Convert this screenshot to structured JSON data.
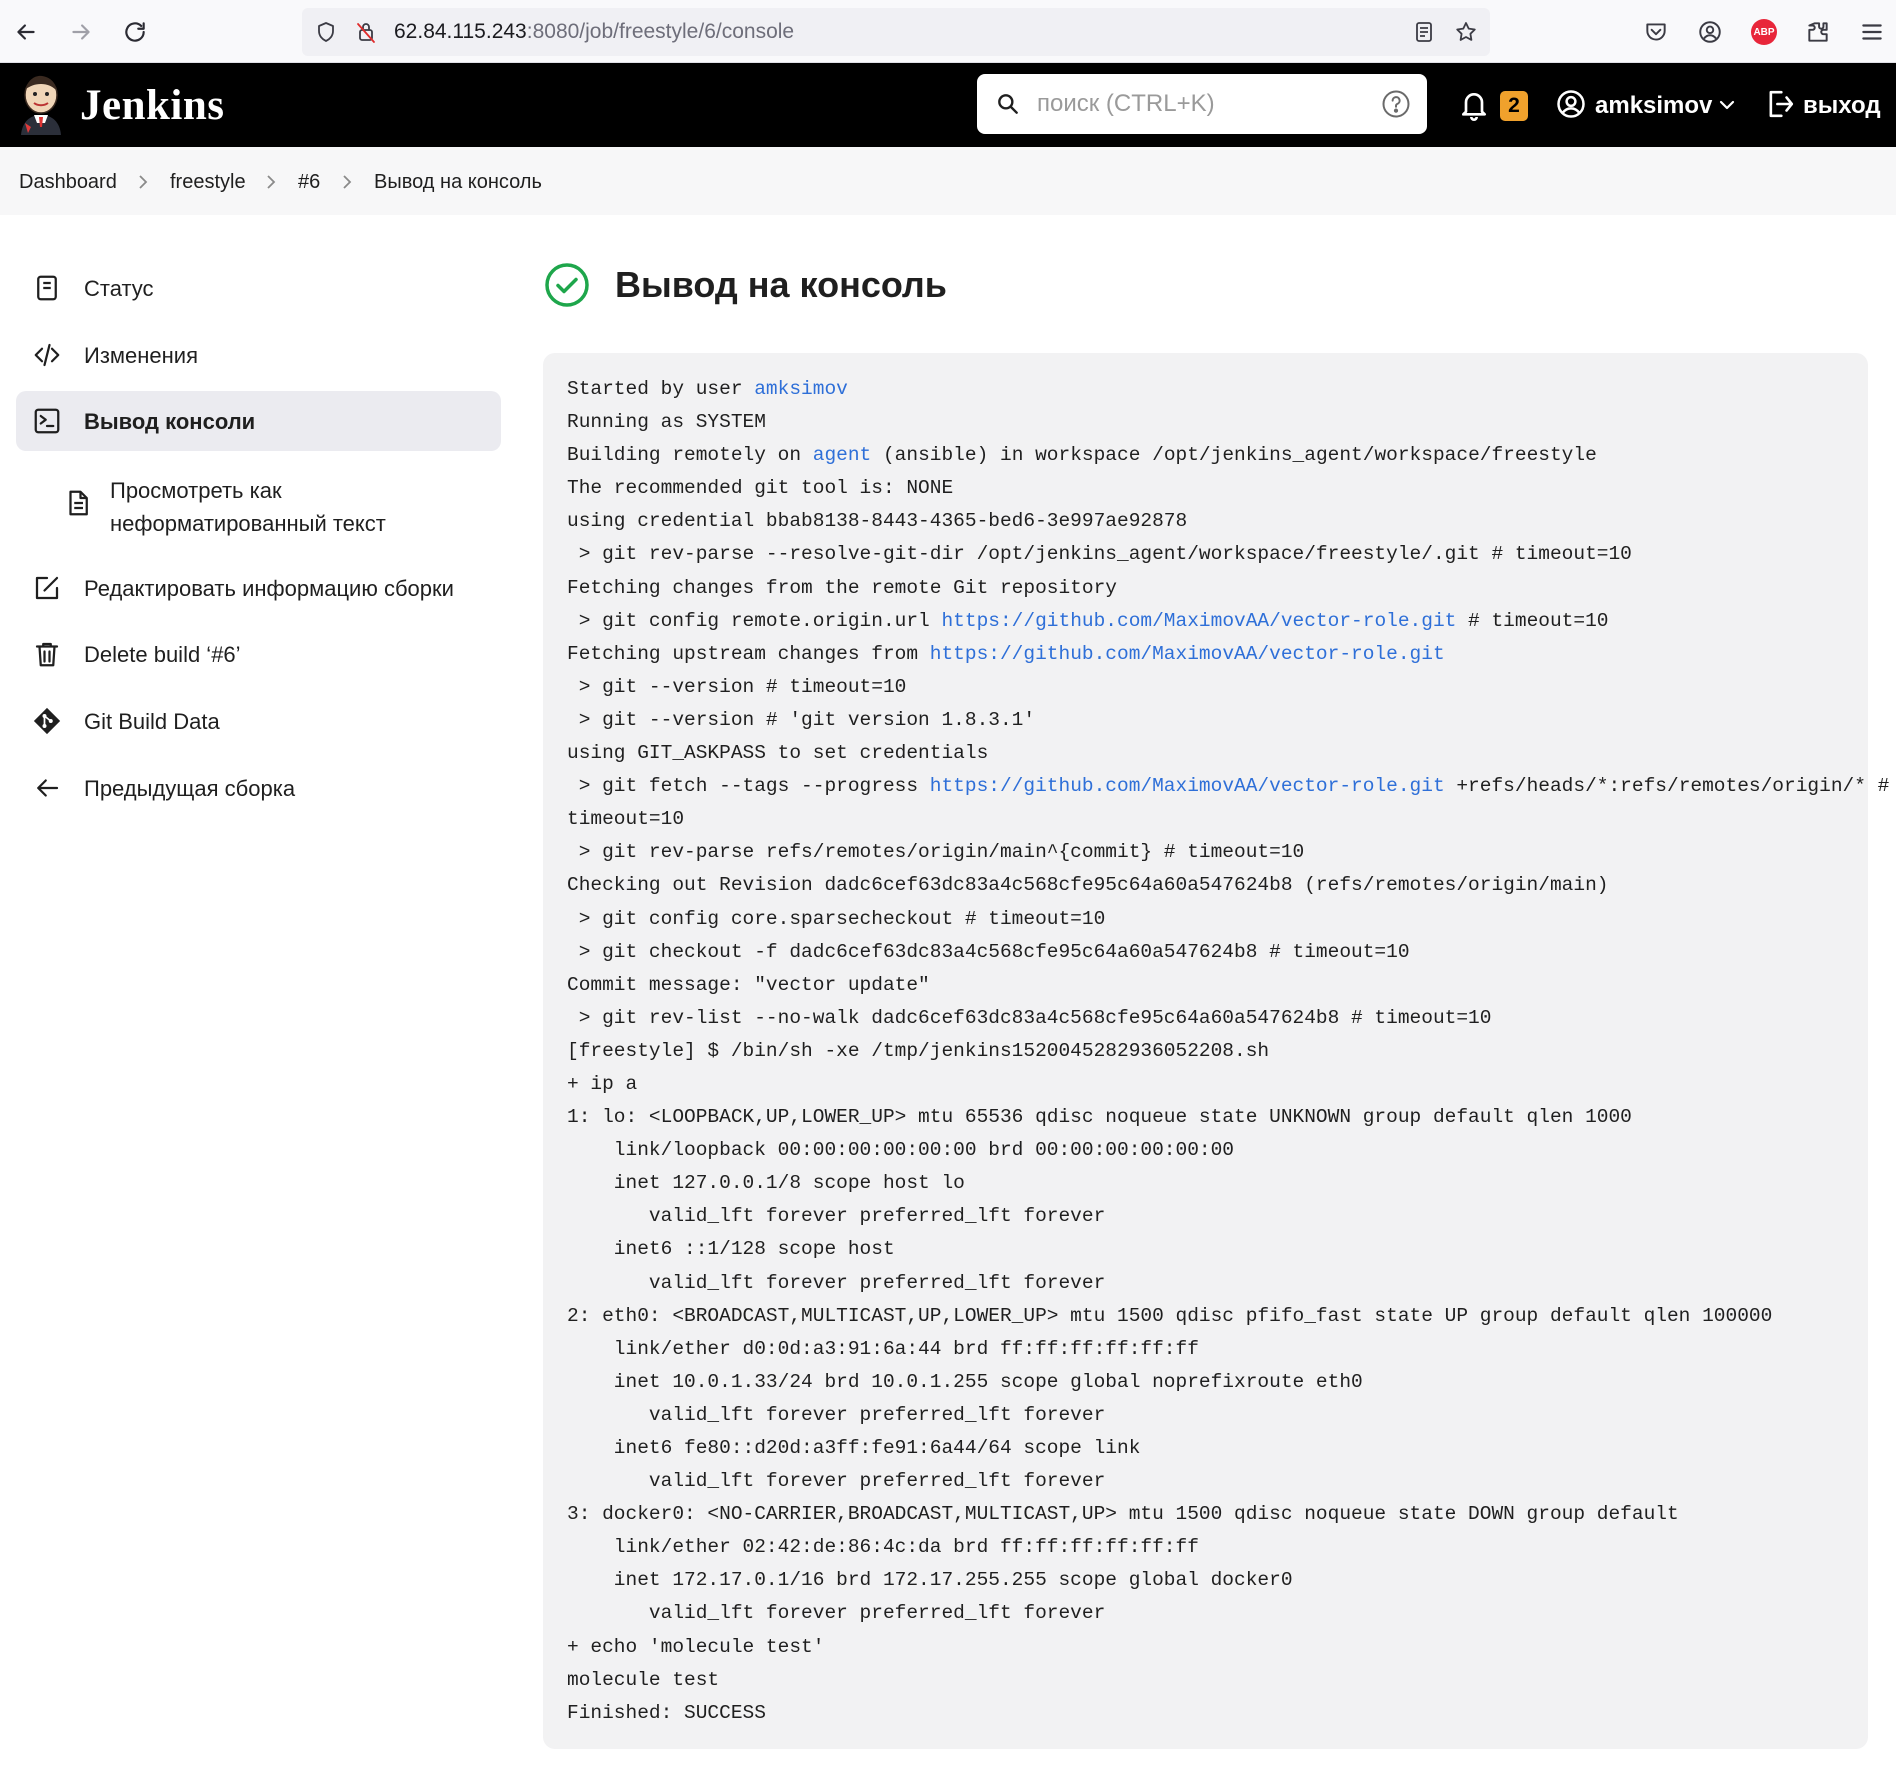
{
  "browser": {
    "url_host": "62.84.115.243",
    "url_rest": ":8080/job/freestyle/6/console"
  },
  "header": {
    "brand": "Jenkins",
    "search_placeholder": "поиск (CTRL+K)",
    "notifications_count": "2",
    "username": "amksimov",
    "logout_label": "выход"
  },
  "breadcrumb": {
    "items": [
      "Dashboard",
      "freestyle",
      "#6",
      "Вывод на консоль"
    ]
  },
  "sidebar": {
    "items": [
      {
        "label": "Статус",
        "icon": "document-icon"
      },
      {
        "label": "Изменения",
        "icon": "code-icon"
      },
      {
        "label": "Вывод консоли",
        "icon": "terminal-icon"
      },
      {
        "label": "Просмотреть как\nнеформатированный текст",
        "icon": "file-text-icon"
      },
      {
        "label": "Редактировать информацию сборки",
        "icon": "edit-icon"
      },
      {
        "label": "Delete build ‘#6’",
        "icon": "trash-icon"
      },
      {
        "label": "Git Build Data",
        "icon": "git-icon"
      },
      {
        "label": "Предыдущая сборка",
        "icon": "arrow-left-icon"
      }
    ],
    "sub_label_line1": "Просмотреть как",
    "sub_label_line2": "неформатированный текст"
  },
  "main": {
    "title": "Вывод на консоль",
    "status_color": "#1ea64b"
  },
  "console": {
    "lines": [
      [
        {
          "t": "Started by user "
        },
        {
          "t": "amksimov",
          "link": true
        }
      ],
      [
        {
          "t": "Running as SYSTEM"
        }
      ],
      [
        {
          "t": "Building remotely on "
        },
        {
          "t": "agent",
          "link": true
        },
        {
          "t": " (ansible) in workspace /opt/jenkins_agent/workspace/freestyle"
        }
      ],
      [
        {
          "t": "The recommended git tool is: NONE"
        }
      ],
      [
        {
          "t": "using credential bbab8138-8443-4365-bed6-3e997ae92878"
        }
      ],
      [
        {
          "t": " > git rev-parse --resolve-git-dir /opt/jenkins_agent/workspace/freestyle/.git # timeout=10"
        }
      ],
      [
        {
          "t": "Fetching changes from the remote Git repository"
        }
      ],
      [
        {
          "t": " > git config remote.origin.url "
        },
        {
          "t": "https://github.com/MaximovAA/vector-role.git",
          "link": true
        },
        {
          "t": " # timeout=10"
        }
      ],
      [
        {
          "t": "Fetching upstream changes from "
        },
        {
          "t": "https://github.com/MaximovAA/vector-role.git",
          "link": true
        }
      ],
      [
        {
          "t": " > git --version # timeout=10"
        }
      ],
      [
        {
          "t": " > git --version # 'git version 1.8.3.1'"
        }
      ],
      [
        {
          "t": "using GIT_ASKPASS to set credentials"
        }
      ],
      [
        {
          "t": " > git fetch --tags --progress "
        },
        {
          "t": "https://github.com/MaximovAA/vector-role.git",
          "link": true
        },
        {
          "t": " +refs/heads/*:refs/remotes/origin/* #"
        }
      ],
      [
        {
          "t": "timeout=10"
        }
      ],
      [
        {
          "t": " > git rev-parse refs/remotes/origin/main^{commit} # timeout=10"
        }
      ],
      [
        {
          "t": "Checking out Revision dadc6cef63dc83a4c568cfe95c64a60a547624b8 (refs/remotes/origin/main)"
        }
      ],
      [
        {
          "t": " > git config core.sparsecheckout # timeout=10"
        }
      ],
      [
        {
          "t": " > git checkout -f dadc6cef63dc83a4c568cfe95c64a60a547624b8 # timeout=10"
        }
      ],
      [
        {
          "t": "Commit message: \"vector update\""
        }
      ],
      [
        {
          "t": " > git rev-list --no-walk dadc6cef63dc83a4c568cfe95c64a60a547624b8 # timeout=10"
        }
      ],
      [
        {
          "t": "[freestyle] $ /bin/sh -xe /tmp/jenkins1520045282936052208.sh"
        }
      ],
      [
        {
          "t": "+ ip a"
        }
      ],
      [
        {
          "t": "1: lo: <LOOPBACK,UP,LOWER_UP> mtu 65536 qdisc noqueue state UNKNOWN group default qlen 1000"
        }
      ],
      [
        {
          "t": "    link/loopback 00:00:00:00:00:00 brd 00:00:00:00:00:00"
        }
      ],
      [
        {
          "t": "    inet 127.0.0.1/8 scope host lo"
        }
      ],
      [
        {
          "t": "       valid_lft forever preferred_lft forever"
        }
      ],
      [
        {
          "t": "    inet6 ::1/128 scope host"
        }
      ],
      [
        {
          "t": "       valid_lft forever preferred_lft forever"
        }
      ],
      [
        {
          "t": "2: eth0: <BROADCAST,MULTICAST,UP,LOWER_UP> mtu 1500 qdisc pfifo_fast state UP group default qlen 100000"
        }
      ],
      [
        {
          "t": "    link/ether d0:0d:a3:91:6a:44 brd ff:ff:ff:ff:ff:ff"
        }
      ],
      [
        {
          "t": "    inet 10.0.1.33/24 brd 10.0.1.255 scope global noprefixroute eth0"
        }
      ],
      [
        {
          "t": "       valid_lft forever preferred_lft forever"
        }
      ],
      [
        {
          "t": "    inet6 fe80::d20d:a3ff:fe91:6a44/64 scope link"
        }
      ],
      [
        {
          "t": "       valid_lft forever preferred_lft forever"
        }
      ],
      [
        {
          "t": "3: docker0: <NO-CARRIER,BROADCAST,MULTICAST,UP> mtu 1500 qdisc noqueue state DOWN group default"
        }
      ],
      [
        {
          "t": "    link/ether 02:42:de:86:4c:da brd ff:ff:ff:ff:ff:ff"
        }
      ],
      [
        {
          "t": "    inet 172.17.0.1/16 brd 172.17.255.255 scope global docker0"
        }
      ],
      [
        {
          "t": "       valid_lft forever preferred_lft forever"
        }
      ],
      [
        {
          "t": "+ echo 'molecule test'"
        }
      ],
      [
        {
          "t": "molecule test"
        }
      ],
      [
        {
          "t": "Finished: SUCCESS"
        }
      ]
    ]
  },
  "colors": {
    "header_bg": "#000000",
    "badge": "#f0a12c",
    "link": "#2e6fd8",
    "success": "#1ea64b",
    "console_bg": "#f2f2f3"
  }
}
